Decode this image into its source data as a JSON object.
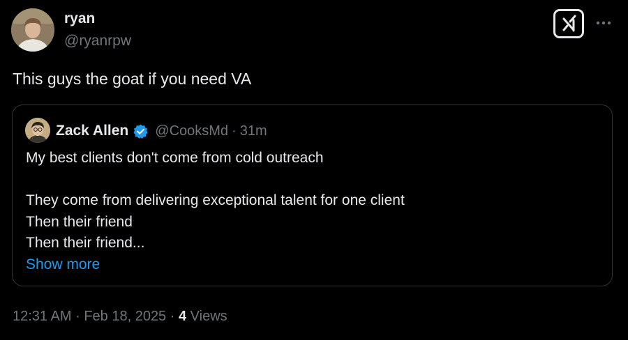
{
  "tweet": {
    "author": {
      "name": "ryan",
      "handle": "@ryanrpw",
      "avatar_icon": "user-avatar-photo"
    },
    "text": "This guys the goat if you need VA",
    "actions": {
      "grok_icon": "grok-icon",
      "more_icon": "more-options-icon"
    },
    "quoted": {
      "author": {
        "name": "Zack Allen",
        "handle": "@CooksMd",
        "verified_icon": "verified-badge-icon",
        "avatar_icon": "quoted-user-avatar-photo"
      },
      "separator": "·",
      "time": "31m",
      "lines": [
        "My best clients don't come from cold outreach",
        "",
        "They come from delivering exceptional talent for one client",
        "Then their friend",
        "Then their friend..."
      ],
      "show_more": "Show more"
    },
    "meta": {
      "time": "12:31 AM",
      "separator": "·",
      "date": "Feb 18, 2025",
      "views_count": "4",
      "views_label": "Views"
    }
  },
  "colors": {
    "background": "#000000",
    "primary_text": "#e7e9ea",
    "secondary_text": "#71767b",
    "link": "#1d9bf0",
    "verified": "#1d9bf0",
    "border": "#2f3336"
  }
}
